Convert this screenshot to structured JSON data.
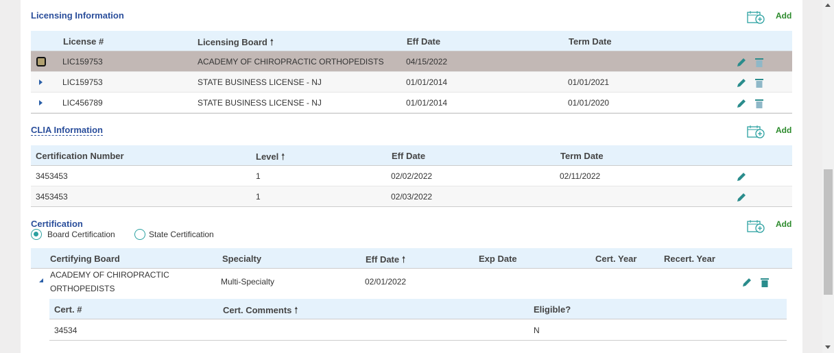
{
  "licensing": {
    "title": "Licensing Information",
    "add_label": "Add",
    "columns": [
      "License #",
      "Licensing Board",
      "Eff Date",
      "Term Date"
    ],
    "sort_arrow": "🠕",
    "rows": [
      {
        "license": "LIC159753",
        "board": "ACADEMY OF CHIROPRACTIC ORTHOPEDISTS",
        "eff": "04/15/2022",
        "term": ""
      },
      {
        "license": "LIC159753",
        "board": "STATE BUSINESS LICENSE - NJ",
        "eff": "01/01/2014",
        "term": "01/01/2021"
      },
      {
        "license": "LIC456789",
        "board": "STATE BUSINESS LICENSE - NJ",
        "eff": "01/01/2014",
        "term": "01/01/2020"
      }
    ]
  },
  "clia": {
    "title": "CLIA Information",
    "add_label": "Add",
    "columns": [
      "Certification Number",
      "Level",
      "Eff Date",
      "Term Date"
    ],
    "rows": [
      {
        "number": "3453453",
        "level": "1",
        "eff": "02/02/2022",
        "term": "02/11/2022"
      },
      {
        "number": "3453453",
        "level": "1",
        "eff": "02/03/2022",
        "term": ""
      }
    ]
  },
  "certification": {
    "title": "Certification",
    "add_label": "Add",
    "radio_options": [
      {
        "label": "Board Certification",
        "selected": true
      },
      {
        "label": "State Certification",
        "selected": false
      }
    ],
    "columns": [
      "Certifying Board",
      "Specialty",
      "Eff Date",
      "Exp Date",
      "Cert. Year",
      "Recert. Year"
    ],
    "rows": [
      {
        "board_line1": "ACADEMY OF CHIROPRACTIC",
        "board_line2": "ORTHOPEDISTS",
        "specialty": "Multi-Specialty",
        "eff": "02/01/2022",
        "exp": "",
        "cert_year": "",
        "recert_year": ""
      }
    ],
    "sub_columns": [
      "Cert. #",
      "Cert. Comments",
      "Eligible?"
    ],
    "sub_rows": [
      {
        "cert": "34534",
        "comments": "",
        "eligible": "N"
      }
    ]
  },
  "colors": {
    "accent": "#2a4e9b",
    "add": "#2b8a2b",
    "icon": "#2aa0a0",
    "selected_row": "#c2b8b5",
    "header": "#e5f2fc"
  }
}
